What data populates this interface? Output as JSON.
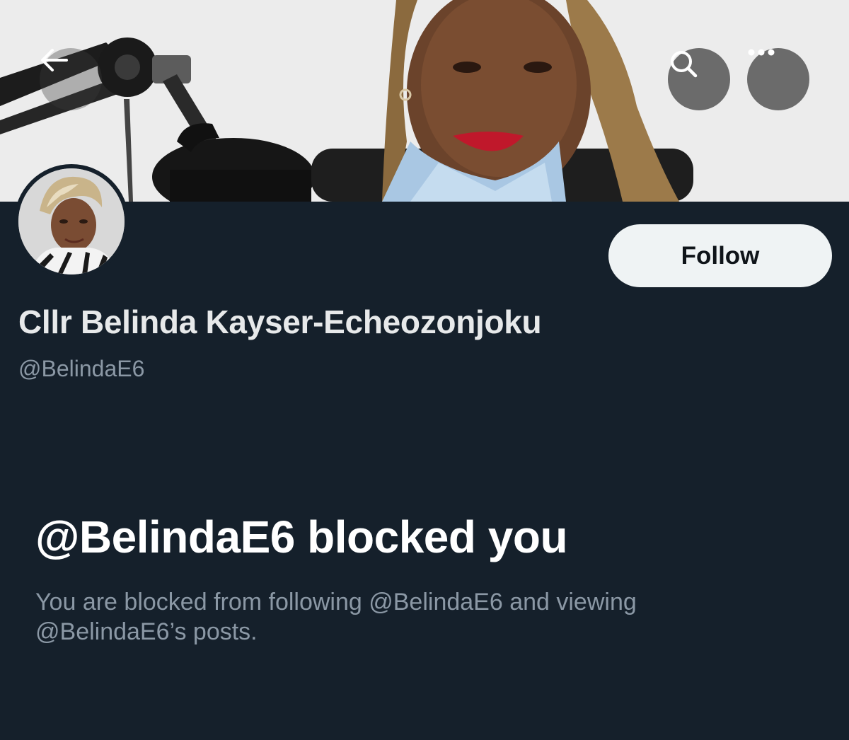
{
  "profile": {
    "display_name": "Cllr Belinda Kayser-Echeozonjoku",
    "handle": "@BelindaE6",
    "follow_label": "Follow"
  },
  "blocked": {
    "title": "@BelindaE6 blocked you",
    "description": "You are blocked from following @BelindaE6 and viewing @BelindaE6’s posts."
  },
  "icons": {
    "back": "arrow-left-icon",
    "search": "search-icon",
    "more": "more-horizontal-icon"
  },
  "colors": {
    "background": "#15202b",
    "primary_text": "#e7e9ea",
    "secondary_text": "#8b98a5",
    "follow_button_bg": "#eff3f4"
  }
}
